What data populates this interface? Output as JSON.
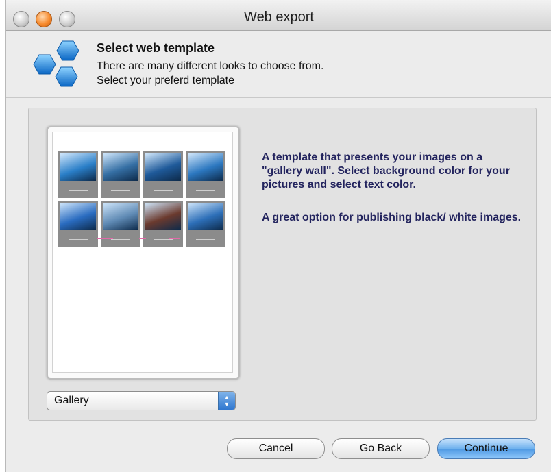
{
  "window": {
    "title": "Web export",
    "controls": [
      "close",
      "minimize",
      "zoom"
    ]
  },
  "header": {
    "icon": "hexagon-cluster-icon",
    "title": "Select web template",
    "line1": "There are many different looks to choose from.",
    "line2": "Select your preferd template"
  },
  "preview": {
    "thumbnail_count": 8,
    "thumbnail_colors": [
      "#2a7fc8",
      "#356fa4",
      "#1f5a9a",
      "#2c78c0",
      "#2a6cc0",
      "#5f8ab4",
      "#6b3a2e",
      "#2d6fb8"
    ]
  },
  "description": {
    "paragraph1": "A template that presents your images on a \"gallery wall\". Select background color for your pictures and select text color.",
    "paragraph2": "A great option for publishing black/ white images."
  },
  "template_select": {
    "selected": "Gallery"
  },
  "buttons": {
    "cancel": "Cancel",
    "go_back": "Go Back",
    "continue": "Continue"
  },
  "colors": {
    "accent_text": "#23245e",
    "default_button": "#6eb1ee"
  }
}
